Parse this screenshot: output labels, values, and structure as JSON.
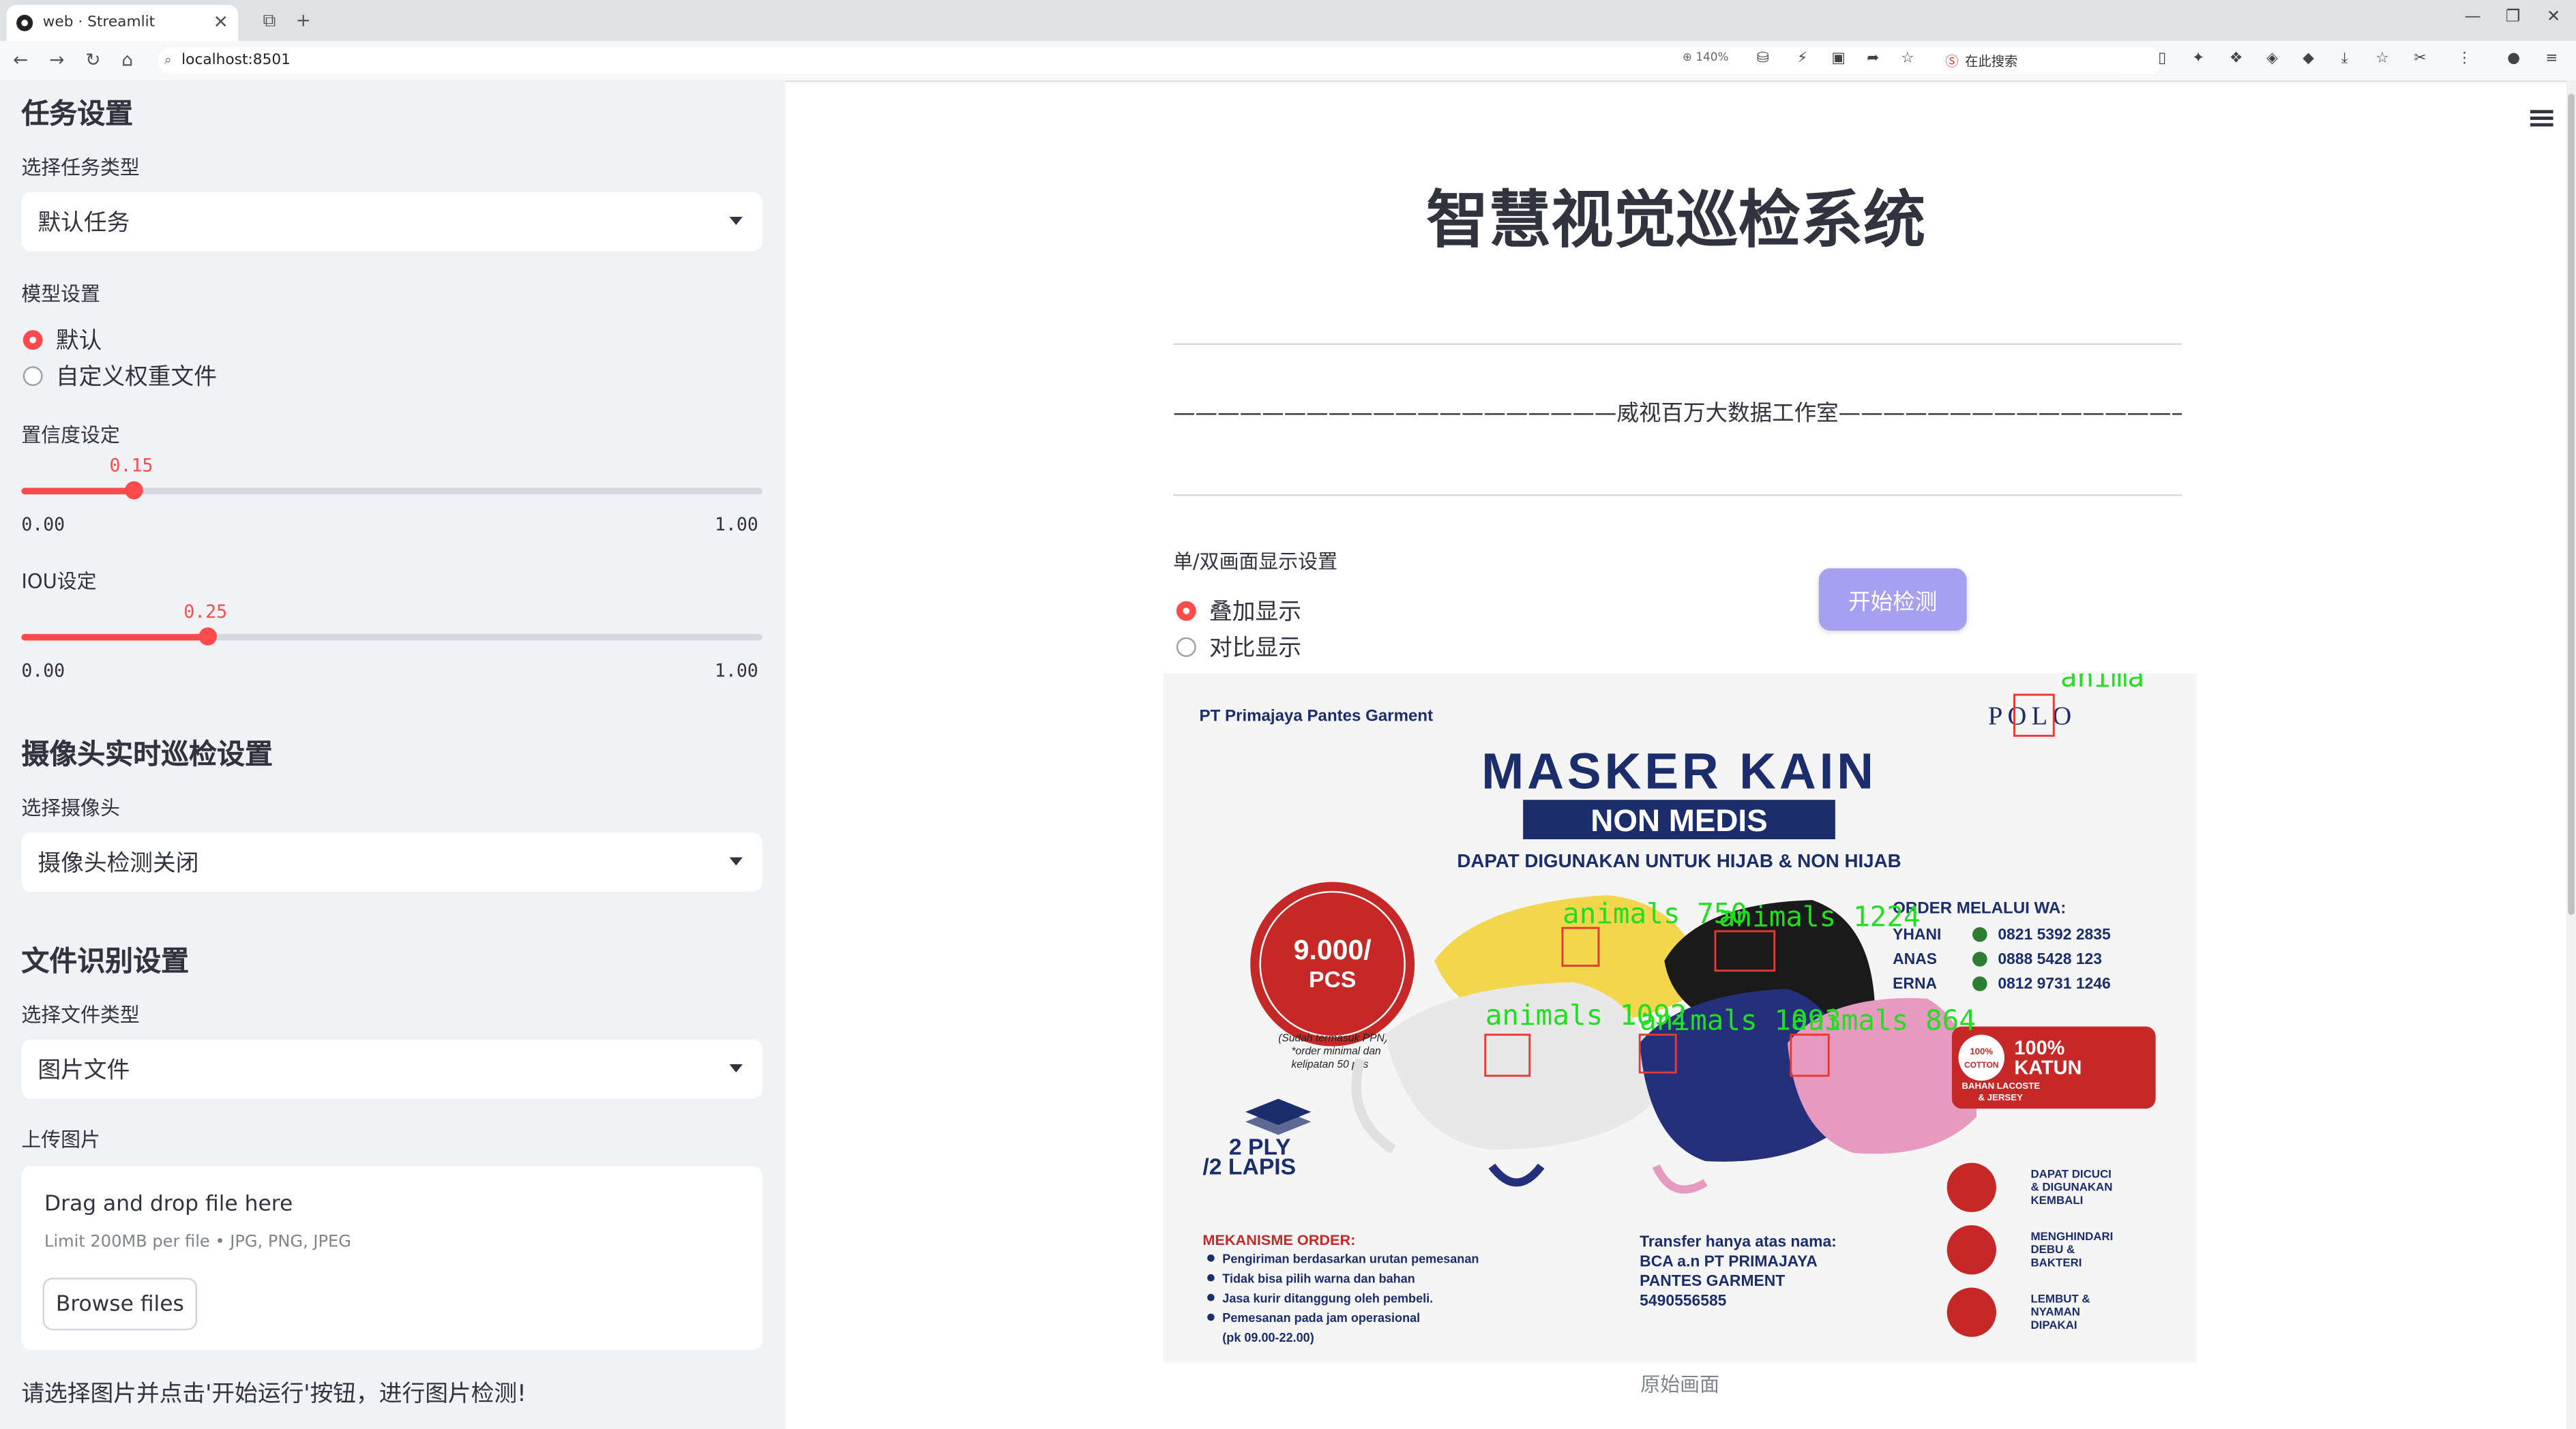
{
  "browser": {
    "tab_title": "web · Streamlit",
    "url": "localhost:8501",
    "zoom": "140%",
    "search_placeholder": "在此搜索"
  },
  "sidebar": {
    "task_header": "任务设置",
    "task_type_label": "选择任务类型",
    "task_type_value": "默认任务",
    "model_label": "模型设置",
    "model_options": [
      "默认",
      "自定义权重文件"
    ],
    "model_selected": 0,
    "confidence_label": "置信度设定",
    "confidence_value": "0.15",
    "confidence_min": "0.00",
    "confidence_max": "1.00",
    "iou_label": "IOU设定",
    "iou_value": "0.25",
    "iou_min": "0.00",
    "iou_max": "1.00",
    "camera_header": "摄像头实时巡检设置",
    "camera_label": "选择摄像头",
    "camera_value": "摄像头检测关闭",
    "file_header": "文件识别设置",
    "file_type_label": "选择文件类型",
    "file_type_value": "图片文件",
    "upload_label": "上传图片",
    "upload_drag_text": "Drag and drop file here",
    "upload_limit_text": "Limit 200MB per file • JPG, PNG, JPEG",
    "browse_button": "Browse files",
    "note": "请选择图片并点击'开始运行'按钮，进行图片检测!"
  },
  "main": {
    "title": "智慧视觉巡检系统",
    "subtitle": "————————————————————威视百万大数据工作室—————————————————————",
    "display_label": "单/双画面显示设置",
    "display_options": [
      "叠加显示",
      "对比显示"
    ],
    "display_selected": 0,
    "start_button": "开始检测",
    "caption": "原始画面"
  },
  "poster": {
    "company": "PT Primajaya Pantes Garment",
    "brand": "POLO",
    "headline": "MASKER KAIN",
    "banner": "NON MEDIS",
    "tagline": "DAPAT DIGUNAKAN UNTUK HIJAB & NON HIJAB",
    "price": "9.000/",
    "price_unit": "PCS",
    "price_note_1": "(Sudah termasuk PPN)",
    "price_note_2": "*order minimal dan",
    "price_note_3": "kelipatan 50 pcs",
    "ply_1": "2 PLY",
    "ply_2": "/2 LAPIS",
    "order_title": "ORDER MELALUI WA:",
    "contacts": [
      {
        "name": "YHANI",
        "phone": "0821 5392 2835"
      },
      {
        "name": "ANAS",
        "phone": "0888 5428 123"
      },
      {
        "name": "ERNA",
        "phone": "0812 9731 1246"
      }
    ],
    "badge_1": "100%",
    "badge_2": "COTTON",
    "katun_1": "100%",
    "katun_2": "KATUN",
    "katun_3": "BAHAN LACOSTE",
    "katun_4": "& JERSEY",
    "mekanisme_title": "MEKANISME ORDER:",
    "mekanisme": [
      "Pengiriman berdasarkan urutan pemesanan",
      "Tidak bisa pilih warna dan bahan",
      "Jasa kurir ditanggung oleh pembeli.",
      "Pemesanan pada jam operasional"
    ],
    "mekanisme_hours": "(pk 09.00-22.00)",
    "transfer_1": "Transfer hanya atas nama:",
    "transfer_2": "BCA a.n PT PRIMAJAYA",
    "transfer_3": "PANTES GARMENT",
    "transfer_4": "5490556585",
    "features": [
      [
        "DAPAT DICUCI",
        "& DIGUNAKAN",
        "KEMBALI"
      ],
      [
        "MENGHINDARI",
        "DEBU &",
        "BAKTERI"
      ],
      [
        "LEMBUT &",
        "NYAMAN",
        "DIPAKAI"
      ]
    ],
    "detections": [
      "anima",
      "animals 750",
      "animals 1224",
      "animals 1092",
      "animals 1093",
      "animals 864"
    ]
  },
  "colors": {
    "accent": "#ff4b4b",
    "start_button": "#a7a0f0",
    "sidebar_bg": "#f0f2f6",
    "detection_box": "#e53935",
    "detection_text": "#22dd22",
    "poster_navy": "#1c2d6b",
    "poster_red": "#d32f2f"
  }
}
